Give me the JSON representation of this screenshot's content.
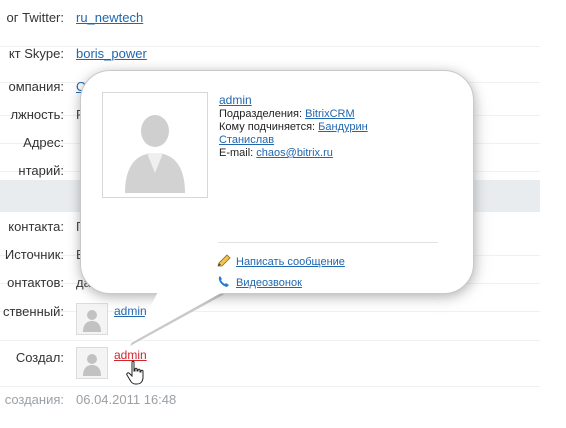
{
  "form": {
    "rows": [
      {
        "label": "ог Twitter:",
        "value": "ru_newtech",
        "link": true
      },
      {
        "label": "кт Skype:",
        "value": "boris_power",
        "link": true
      },
      {
        "label": "омпания:",
        "value": "О",
        "link": true
      },
      {
        "label": "лжность:",
        "value": "Р",
        "link": false
      },
      {
        "label": "Адрес:",
        "value": "",
        "link": false
      },
      {
        "label": "нтарий:",
        "value": "",
        "link": false
      },
      {
        "label": "контакта:",
        "value": "Г",
        "link": false
      },
      {
        "label": "Источник:",
        "value": "В",
        "link": false
      },
      {
        "label": "онтактов:",
        "value": "да",
        "link": false
      },
      {
        "label": "ственный:",
        "value": "admin",
        "link": true
      },
      {
        "label": "Создал:",
        "value": "admin",
        "link": true
      },
      {
        "label": "создания:",
        "value": "06.04.2011 16:48",
        "link": false
      }
    ]
  },
  "popup": {
    "name": "admin",
    "department_label": "Подразделения:",
    "department_value": "BitrixCRM",
    "manager_label": "Кому подчиняется:",
    "manager_value_line1": "Бандурин",
    "manager_value_line2": "Станислав",
    "email_label": "E-mail:",
    "email_value": "chaos@bitrix.ru",
    "actions": {
      "message": "Написать сообщение",
      "video": "Видеозвонок"
    }
  },
  "colors": {
    "link": "#2067b0",
    "active_link": "#d1252b",
    "section_band": "#e9ecef"
  }
}
